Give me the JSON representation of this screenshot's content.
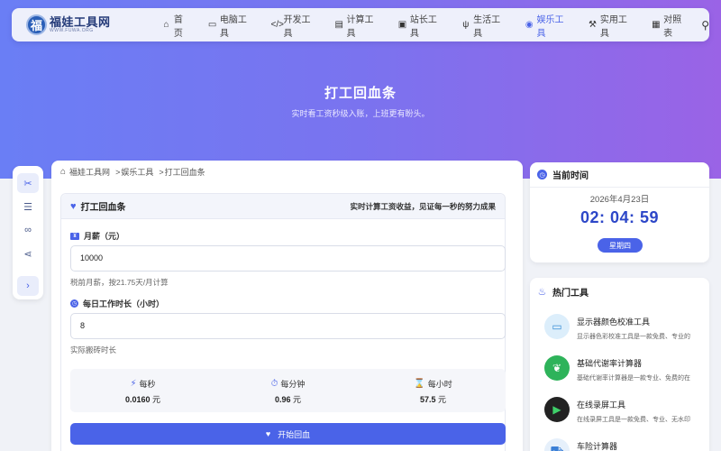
{
  "brand": {
    "title": "福娃工具网",
    "subtitle": "WWW.FUWA.ORG",
    "mark": "福"
  },
  "nav": {
    "items": [
      {
        "label": "首页",
        "icon": "home-icon",
        "glyph": "⌂"
      },
      {
        "label": "电脑工具",
        "icon": "desktop-icon",
        "glyph": "▭"
      },
      {
        "label": "开发工具",
        "icon": "code-icon",
        "glyph": "</>"
      },
      {
        "label": "计算工具",
        "icon": "calculator-icon",
        "glyph": "▤"
      },
      {
        "label": "站长工具",
        "icon": "toolbox-icon",
        "glyph": "▣"
      },
      {
        "label": "生活工具",
        "icon": "utensils-icon",
        "glyph": "ψ"
      },
      {
        "label": "娱乐工具",
        "icon": "gamepad-icon",
        "glyph": "◉",
        "active": true
      },
      {
        "label": "实用工具",
        "icon": "wrench-icon",
        "glyph": "⚒"
      },
      {
        "label": "对照表",
        "icon": "table-icon",
        "glyph": "▦"
      }
    ],
    "search_glyph": "⚲"
  },
  "hero": {
    "title": "打工回血条",
    "subtitle": "实时看工资秒级入账，上班更有盼头。"
  },
  "breadcrumb": {
    "home": "福娃工具网",
    "level1": "娱乐工具",
    "level2": "打工回血条",
    "sep": ">"
  },
  "tool": {
    "title": "打工回血条",
    "description": "实时计算工资收益，见证每一秒的努力成果",
    "salary": {
      "label": "月薪（元）",
      "value": "10000",
      "help": "税前月薪，按21.75天/月计算"
    },
    "hours": {
      "label": "每日工作时长（小时）",
      "value": "8",
      "help": "实际搬砖时长"
    },
    "stats": [
      {
        "label": "每秒",
        "value": "0.0160",
        "unit": "元",
        "glyph": "⚡"
      },
      {
        "label": "每分钟",
        "value": "0.96",
        "unit": "元",
        "glyph": "⏱"
      },
      {
        "label": "每小时",
        "value": "57.5",
        "unit": "元",
        "glyph": "⌛"
      }
    ],
    "start_button": "开始回血"
  },
  "time_card": {
    "title": "当前时间",
    "date": "2026年4月23日",
    "clock": "02: 04: 59",
    "weekday": "星期四"
  },
  "hot_tools": {
    "title": "热门工具",
    "items": [
      {
        "name": "显示器颜色校准工具",
        "desc": "显示器色彩校准工具是一款免费、专业的",
        "bg": "#dceefb",
        "fg": "#3a8fd6",
        "glyph": "▭"
      },
      {
        "name": "基础代谢率计算器",
        "desc": "基础代谢率计算器是一款专业、免费的在",
        "bg": "#2eb35a",
        "fg": "#ffffff",
        "glyph": "❦"
      },
      {
        "name": "在线录屏工具",
        "desc": "在线录屏工具是一款免费、专业、无水印",
        "bg": "#222222",
        "fg": "#3fd06a",
        "glyph": "▶"
      },
      {
        "name": "车险计算器",
        "desc": "",
        "bg": "#e6f0fb",
        "fg": "#3a7fd6",
        "glyph": "⛟"
      }
    ]
  },
  "colors": {
    "accent": "#4a63e8",
    "hero_start": "#6a7ef5",
    "hero_end": "#9a63e6"
  }
}
